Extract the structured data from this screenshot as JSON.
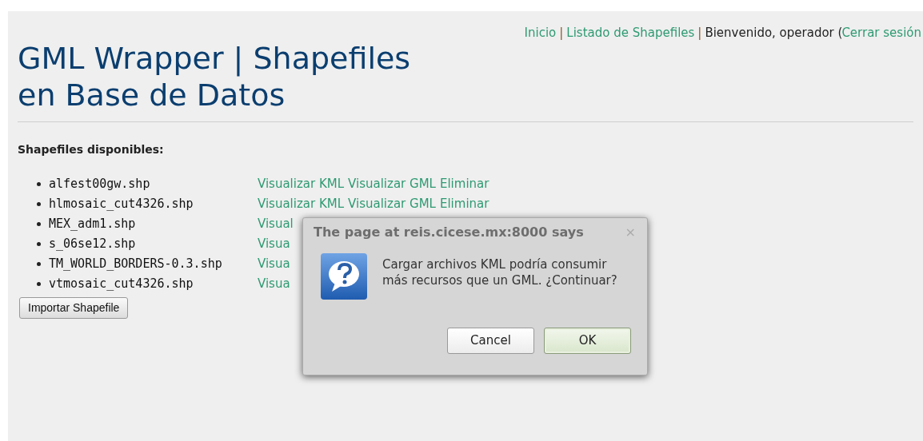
{
  "nav": [
    {
      "kind": "link",
      "text": "Inicio"
    },
    {
      "kind": "sep",
      "text": "|"
    },
    {
      "kind": "link",
      "text": "Listado de Shapefiles"
    },
    {
      "kind": "sep",
      "text": "|"
    },
    {
      "kind": "text",
      "text": "Bienvenido, operador ("
    },
    {
      "kind": "link",
      "text": "Cerrar sesión"
    }
  ],
  "title": "GML Wrapper | Shapefiles en Base de Datos",
  "heading": "Shapefiles disponibles:",
  "shapefiles": [
    {
      "file": "alfest00gw.shp",
      "links": [
        "Visualizar KML",
        "Visualizar GML",
        "Eliminar"
      ]
    },
    {
      "file": "hlmosaic_cut4326.shp",
      "links": [
        "Visualizar KML",
        "Visualizar GML",
        "Eliminar"
      ]
    },
    {
      "file": "MEX_adm1.shp",
      "links": [
        "Visual"
      ]
    },
    {
      "file": "s_06se12.shp",
      "links": [
        "Visua"
      ]
    },
    {
      "file": "TM_WORLD_BORDERS-0.3.shp",
      "links": [
        "Visua"
      ]
    },
    {
      "file": "vtmosaic_cut4326.shp",
      "links": [
        "Visua"
      ]
    }
  ],
  "import_button": "Importar Shapefile",
  "dialog": {
    "title": "The page at reis.cicese.mx:8000 says",
    "close": "×",
    "message": "Cargar archivos KML podría consumir más recursos que un GML. ¿Continuar?",
    "buttons": [
      {
        "label": "Cancel",
        "default": false
      },
      {
        "label": "OK",
        "default": true
      }
    ]
  }
}
